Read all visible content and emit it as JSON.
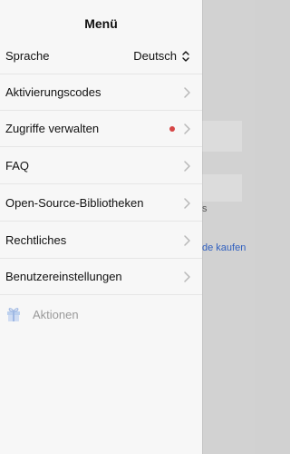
{
  "menu": {
    "title": "Menü",
    "language": {
      "label": "Sprache",
      "value": "Deutsch"
    },
    "items": [
      {
        "label": "Aktivierungscodes"
      },
      {
        "label": "Zugriffe verwalten",
        "badge": true
      },
      {
        "label": "FAQ"
      },
      {
        "label": "Open-Source-Bibliotheken"
      },
      {
        "label": "Rechtliches"
      },
      {
        "label": "Benutzereinstellungen"
      }
    ],
    "actions": {
      "label": "Aktionen"
    }
  },
  "background": {
    "partial_text": "s",
    "partial_link": "de kaufen"
  },
  "colors": {
    "drawer_bg": "#f7f7f7",
    "overlay_bg": "#d2d2d2",
    "badge": "#d64646",
    "link": "#2f5fbf",
    "disabled_text": "#9a9a9a"
  }
}
